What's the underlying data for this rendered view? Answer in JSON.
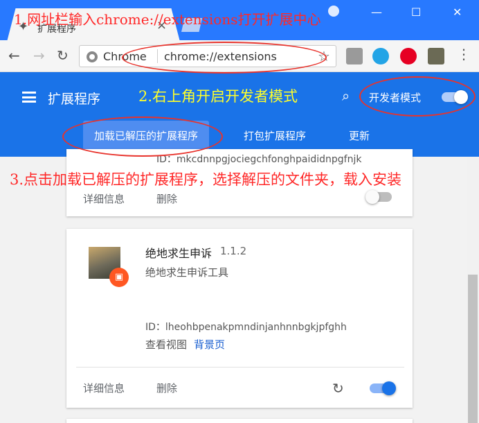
{
  "browser": {
    "tab_title": "扩展程序",
    "tab_close": "×",
    "omnibox_chip": "Chrome",
    "omnibox_url": "chrome://extensions",
    "window_buttons": [
      "—",
      "☐",
      "✕"
    ]
  },
  "extensions_page": {
    "title": "扩展程序",
    "developer_mode_label": "开发者模式",
    "developer_mode_on": true,
    "subnav": [
      "加载已解压的扩展程序",
      "打包扩展程序",
      "更新"
    ]
  },
  "annotations": {
    "step1": "1.网址栏输入chrome://extensions打开扩展中心",
    "step2": "2.右上角开启开发者模式",
    "step3": "3.点击加载已解压的扩展程序，选择解压的文件夹，载入安装"
  },
  "cards": [
    {
      "id_partial": "ID：mkcdnnpgjociegchfonghpaididnpgfnjk",
      "details": "详细信息",
      "remove": "删除",
      "enabled": false
    },
    {
      "name": "绝地求生申诉",
      "version": "1.1.2",
      "description": "绝地求生申诉工具",
      "id": "ID：lheohbpenakpmndinjanhnnbgkjpfghh",
      "views_label": "查看视图",
      "views_link": "背景页",
      "details": "详细信息",
      "remove": "删除",
      "enabled": true
    }
  ],
  "colors": {
    "header_blue": "#1a73e8",
    "titlebar_blue": "#2879ff",
    "annotation_red": "#ff2828",
    "annotation_yellow": "#ffff2a"
  }
}
